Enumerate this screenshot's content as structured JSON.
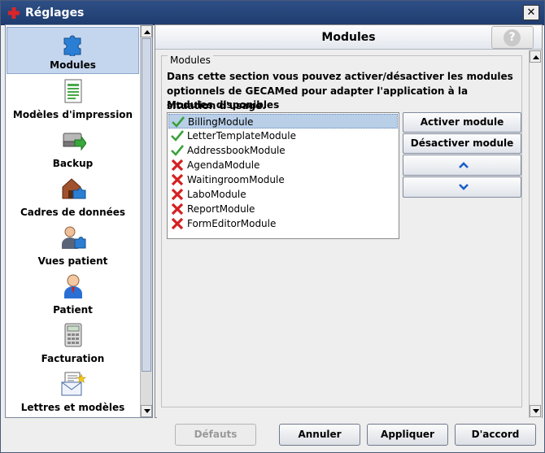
{
  "window": {
    "title": "Réglages",
    "close_glyph": "✕",
    "app_icon": "red-cross-icon"
  },
  "sidebar": {
    "items": [
      {
        "label": "Modules",
        "icon": "puzzle-icon",
        "selected": true
      },
      {
        "label": "Modèles d'impression",
        "icon": "print-template-icon",
        "selected": false
      },
      {
        "label": "Backup",
        "icon": "backup-drive-icon",
        "selected": false
      },
      {
        "label": "Cadres de données",
        "icon": "data-frames-icon",
        "selected": false
      },
      {
        "label": "Vues patient",
        "icon": "patient-views-icon",
        "selected": false
      },
      {
        "label": "Patient",
        "icon": "patient-icon",
        "selected": false
      },
      {
        "label": "Facturation",
        "icon": "calculator-icon",
        "selected": false
      },
      {
        "label": "Lettres et modèles",
        "icon": "letter-icon",
        "selected": false
      }
    ]
  },
  "main": {
    "title": "Modules",
    "help_glyph": "?",
    "section_title": "Modules",
    "description": "Dans cette section vous pouvez activer/désactiver les modules optionnels de GECAMed pour adapter l'application à la situation d'usage.",
    "available_label": "Modules disponibles",
    "modules": [
      {
        "name": "BillingModule",
        "active": true,
        "selected": true
      },
      {
        "name": "LetterTemplateModule",
        "active": true,
        "selected": false
      },
      {
        "name": "AddressbookModule",
        "active": true,
        "selected": false
      },
      {
        "name": "AgendaModule",
        "active": false,
        "selected": false
      },
      {
        "name": "WaitingroomModule",
        "active": false,
        "selected": false
      },
      {
        "name": "LaboModule",
        "active": false,
        "selected": false
      },
      {
        "name": "ReportModule",
        "active": false,
        "selected": false
      },
      {
        "name": "FormEditorModule",
        "active": false,
        "selected": false
      }
    ],
    "buttons": {
      "activate": "Activer module",
      "deactivate": "Désactiver module",
      "move_up": "chevron-up-icon",
      "move_down": "chevron-down-icon"
    }
  },
  "footer": {
    "defaults": "Défauts",
    "cancel": "Annuler",
    "apply": "Appliquer",
    "ok": "D'accord"
  },
  "colors": {
    "titlebar": "#1f3c6e",
    "selection": "#c4d6ee",
    "check_green": "#3aa13a",
    "cross_red": "#d42020"
  }
}
